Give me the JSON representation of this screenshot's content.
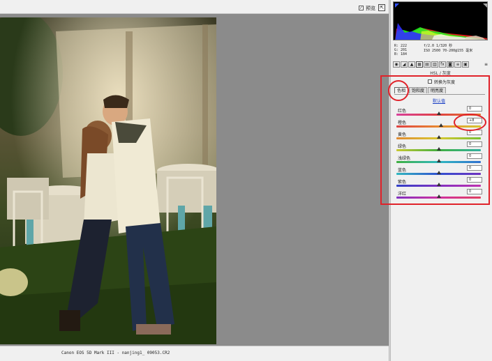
{
  "toolbar": {
    "preview_check": "✓",
    "preview_label": "预览",
    "fullscreen_icon": "fullscreen-icon"
  },
  "status_bar": {
    "camera_info": "Canon EOS 5D Mark III - nanjing1_ 09053.CR2"
  },
  "histogram": {
    "colors": {
      "red": "#ff2020",
      "green": "#20ff20",
      "blue": "#3030ff",
      "yellow": "#ffff30",
      "white": "#ffffff"
    }
  },
  "readout": {
    "r": "R:  222",
    "g": "G:  201",
    "b": "B:  184",
    "exif_line1": "f/2.0   1/320 秒",
    "exif_line2": "ISO 2500   70-200@155 毫米"
  },
  "tools": [
    {
      "name": "basic-icon",
      "glyph": "◉"
    },
    {
      "name": "tone-curve-icon",
      "glyph": "◢"
    },
    {
      "name": "detail-icon",
      "glyph": "▲"
    },
    {
      "name": "hsl-icon",
      "glyph": "▦"
    },
    {
      "name": "split-toning-icon",
      "glyph": "▤"
    },
    {
      "name": "lens-icon",
      "glyph": "▥"
    },
    {
      "name": "effects-icon",
      "glyph": "fx"
    },
    {
      "name": "camera-calibration-icon",
      "glyph": "◙"
    },
    {
      "name": "presets-icon",
      "glyph": "≡"
    },
    {
      "name": "snapshots-icon",
      "glyph": "▣"
    }
  ],
  "panel": {
    "menu_icon": "≡",
    "title": "HSL / 灰度",
    "grayscale_label": "转换为灰度",
    "tabs": [
      "色相",
      "饱和度",
      "明亮度"
    ],
    "active_tab": 0,
    "default_link": "默认值"
  },
  "sliders": [
    {
      "label": "红色",
      "value": "0",
      "position": 0.5,
      "gradient": "linear-gradient(90deg,#d8409a,#e04040,#e07a30)"
    },
    {
      "label": "橙色",
      "value": "+8",
      "position": 0.53,
      "gradient": "linear-gradient(90deg,#e04040,#e88a30,#d8c830)"
    },
    {
      "label": "黄色",
      "value": "0",
      "position": 0.5,
      "gradient": "linear-gradient(90deg,#e08a30,#d8c830,#78c030)"
    },
    {
      "label": "绿色",
      "value": "0",
      "position": 0.5,
      "gradient": "linear-gradient(90deg,#c8c830,#40b040,#30b0a0)"
    },
    {
      "label": "浅绿色",
      "value": "0",
      "position": 0.5,
      "gradient": "linear-gradient(90deg,#40b040,#30b8c0,#3070d0)"
    },
    {
      "label": "蓝色",
      "value": "0",
      "position": 0.5,
      "gradient": "linear-gradient(90deg,#30b8c0,#3050d0,#7030c0)"
    },
    {
      "label": "紫色",
      "value": "0",
      "position": 0.5,
      "gradient": "linear-gradient(90deg,#3040c8,#8030c0,#c030b0)"
    },
    {
      "label": "洋红",
      "value": "0",
      "position": 0.5,
      "gradient": "linear-gradient(90deg,#8030c0,#d030a0,#e04060)"
    }
  ],
  "annotation_color": "#e0222a"
}
